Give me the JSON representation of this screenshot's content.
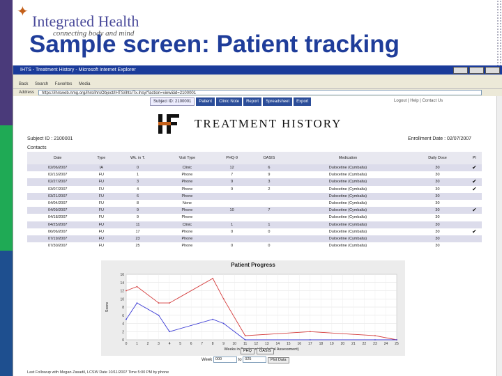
{
  "slide": {
    "title": "Sample screen: Patient tracking",
    "logo_name": "Integrated Health",
    "logo_tagline": "connecting body and mind"
  },
  "browser": {
    "window_title": "IHTS - Treatment History - Microsoft Internet Explorer",
    "address_label": "Address",
    "address_url": "https://ihrsweb.nmg.org/ihrs/ihrsObject/IHTS/ihts/Tx.ihsyl?action=view&id=2100001",
    "toolbar_items": [
      "Back",
      "Search",
      "Favorites",
      "Media"
    ]
  },
  "nav": {
    "subject_id": "Subject ID: 2100001",
    "items": [
      "Patient",
      "Clinic Note",
      "Report",
      "Spreadsheet",
      "Export"
    ],
    "right_links": "Logout  |  Help  |  Contact Us"
  },
  "page": {
    "heading": "Treatment History",
    "subject_line": "Subject ID : 2100001",
    "enrollment_line": "Enrollment Date : 02/07/2007",
    "contacts_label": "Contacts"
  },
  "table": {
    "headers": [
      "Date",
      "Type",
      "Wk. in T.",
      "Visit Type",
      "PHQ-9",
      "OASIS",
      "Medication",
      "Daily Dose",
      "PI"
    ],
    "rows": [
      [
        "02/06/2007",
        "IA",
        "0",
        "Clinic",
        "12",
        "6",
        "Duloxetine (Cymbalta)",
        "30",
        "✔"
      ],
      [
        "02/13/2007",
        "FU",
        "1",
        "Phone",
        "7",
        "9",
        "Duloxetine (Cymbalta)",
        "30",
        ""
      ],
      [
        "02/27/2007",
        "FU",
        "3",
        "Phone",
        "9",
        "3",
        "Duloxetine (Cymbalta)",
        "30",
        "✔"
      ],
      [
        "03/07/2007",
        "FU",
        "4",
        "Phone",
        "9",
        "2",
        "Duloxetine (Cymbalta)",
        "30",
        "✔"
      ],
      [
        "03/21/2007",
        "FU",
        "6",
        "Phone",
        "",
        "",
        "Duloxetine (Cymbalta)",
        "30",
        ""
      ],
      [
        "04/04/2007",
        "FU",
        "8",
        "None",
        "",
        "",
        "Duloxetine (Cymbalta)",
        "30",
        ""
      ],
      [
        "04/09/2007",
        "FU",
        "9",
        "Phone",
        "10",
        "7",
        "Duloxetine (Cymbalta)",
        "30",
        "✔"
      ],
      [
        "04/18/2007",
        "FU",
        "9",
        "Phone",
        "",
        "",
        "Duloxetine (Cymbalta)",
        "30",
        ""
      ],
      [
        "04/25/2007",
        "FU",
        "11",
        "Clinic",
        "1",
        "1",
        "Duloxetine (Cymbalta)",
        "30",
        ""
      ],
      [
        "06/06/2007",
        "FU",
        "17",
        "Phone",
        "0",
        "0",
        "Duloxetine (Cymbalta)",
        "30",
        "✔"
      ],
      [
        "07/19/2007",
        "FU",
        "23",
        "Phone",
        "",
        "",
        "Duloxetine (Cymbalta)",
        "30",
        ""
      ],
      [
        "07/30/2007",
        "FU",
        "25",
        "Phone",
        "0",
        "0",
        "Duloxetine (Cymbalta)",
        "30",
        ""
      ]
    ]
  },
  "chart_data": {
    "type": "line",
    "title": "Patient Progress",
    "xlabel": "Weeks in Treatment (0 = Initial Assessment)",
    "ylabel": "Score",
    "xlim": [
      0,
      25
    ],
    "ylim": [
      0,
      16
    ],
    "xticks": [
      0,
      1,
      2,
      3,
      4,
      5,
      6,
      7,
      8,
      9,
      10,
      11,
      12,
      13,
      14,
      15,
      16,
      17,
      18,
      19,
      20,
      21,
      22,
      23,
      24,
      25
    ],
    "yticks": [
      0,
      2,
      4,
      6,
      8,
      10,
      12,
      14,
      16
    ],
    "grid": true,
    "series": [
      {
        "name": "PHQ",
        "color": "#d43a3a",
        "points": [
          [
            0,
            12
          ],
          [
            1,
            13
          ],
          [
            3,
            9
          ],
          [
            4,
            9
          ],
          [
            8,
            15
          ],
          [
            9,
            10
          ],
          [
            11,
            1
          ],
          [
            17,
            2
          ],
          [
            23,
            1
          ],
          [
            25,
            0
          ]
        ]
      },
      {
        "name": "OASIS",
        "color": "#3a3ad4",
        "points": [
          [
            0,
            5
          ],
          [
            1,
            9
          ],
          [
            3,
            6
          ],
          [
            4,
            2
          ],
          [
            8,
            5
          ],
          [
            9,
            4
          ],
          [
            11,
            0
          ],
          [
            17,
            0
          ],
          [
            23,
            0
          ],
          [
            25,
            0
          ]
        ]
      }
    ],
    "legend": [
      "PHQ",
      "OASIS"
    ]
  },
  "chart_controls": {
    "week_label": "Week",
    "week_from": "000",
    "to_label": "to",
    "week_to": "025",
    "plot_button": "Plot Data"
  },
  "footer": {
    "text": "Last Followup with Megan Zasadil, LCSW    Date 10/11/2007    Time 5:00 PM    by phone"
  }
}
